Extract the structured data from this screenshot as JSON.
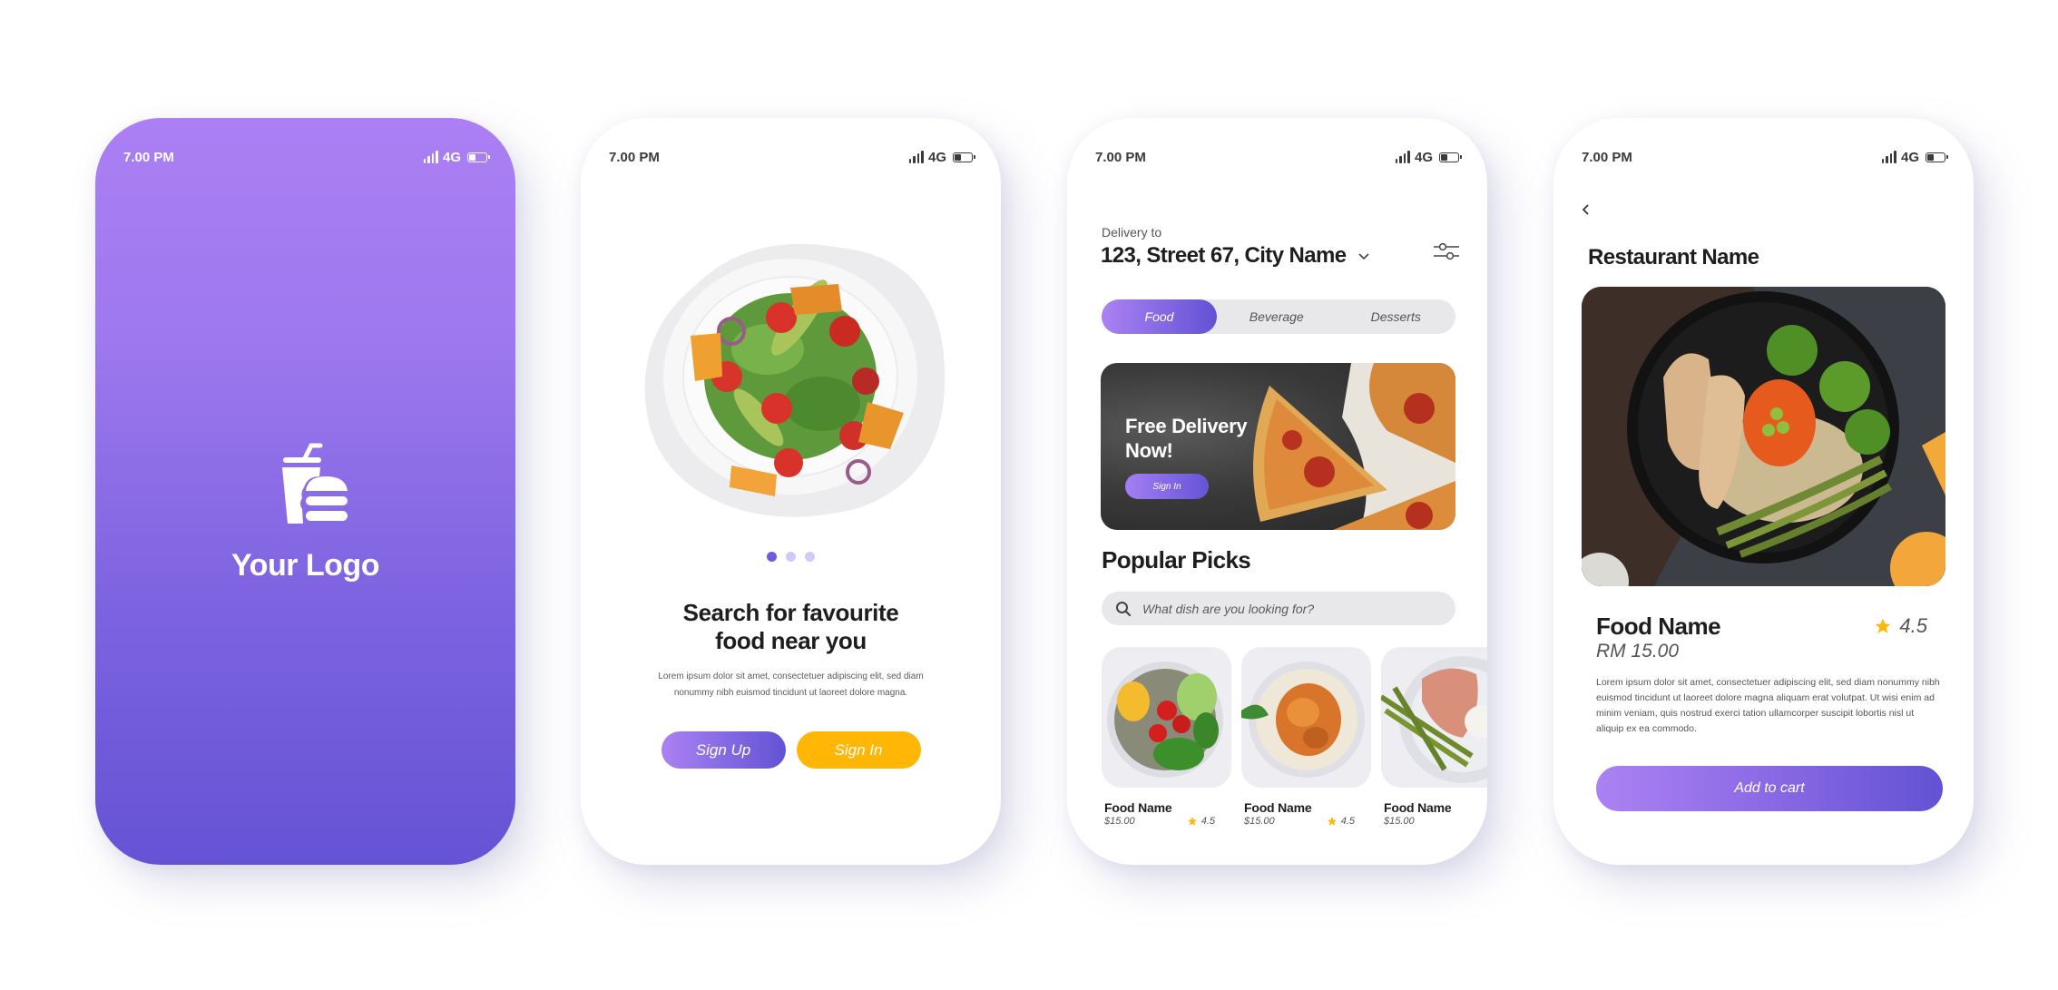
{
  "status_bar": {
    "time": "7.00 PM",
    "network": "4G"
  },
  "colors": {
    "primary_gradient_start": "#ab82f3",
    "primary_gradient_end": "#6252d4",
    "accent_yellow": "#ffb605",
    "star": "#ffb605",
    "text_dark": "#1e1e1e",
    "text_muted": "#555555"
  },
  "splash": {
    "logo_icon": "drink-burger-icon",
    "logo_text": "Your Logo"
  },
  "onboarding": {
    "hero_image": "salad-plate-image",
    "pagination": {
      "total": 3,
      "active": 1
    },
    "title_line1": "Search for favourite",
    "title_line2": "food near you",
    "description_line1": "Lorem ipsum dolor sit amet, consectetuer adipiscing elit, sed diam",
    "description_line2": "nonummy nibh euismod tincidunt ut laoreet dolore magna.",
    "signup_label": "Sign Up",
    "signin_label": "Sign In"
  },
  "home": {
    "delivery_label": "Delivery to",
    "address": "123, Street 67, City Name",
    "filter_icon": "sliders-icon",
    "tabs": [
      {
        "label": "Food",
        "active": true
      },
      {
        "label": "Beverage",
        "active": false
      },
      {
        "label": "Desserts",
        "active": false
      }
    ],
    "banner": {
      "title_line1": "Free Delivery",
      "title_line2": "Now!",
      "button_label": "Sign In",
      "image": "pizza-slices-image"
    },
    "section_title": "Popular Picks",
    "search_placeholder": "What dish are you looking for?",
    "items": [
      {
        "name": "Food Name",
        "price": "$15.00",
        "rating": "4.5",
        "image": "veggie-bowl-image"
      },
      {
        "name": "Food Name",
        "price": "$15.00",
        "rating": "4.5",
        "image": "pasta-bowl-image"
      },
      {
        "name": "Food Name",
        "price": "$15.00",
        "rating": "",
        "image": "grilled-fish-asparagus-image"
      }
    ]
  },
  "detail": {
    "restaurant_name": "Restaurant Name",
    "hero_image": "chicken-bowl-image",
    "food_name": "Food Name",
    "price": "RM 15.00",
    "rating": "4.5",
    "description": "Lorem ipsum dolor sit amet, consectetuer adipiscing elit, sed diam nonummy nibh euismod tincidunt ut laoreet dolore magna aliquam erat volutpat. Ut wisi enim ad minim veniam, quis nostrud exerci tation ullamcorper suscipit lobortis nisl ut aliquip ex ea commodo.",
    "add_to_cart_label": "Add to cart"
  }
}
